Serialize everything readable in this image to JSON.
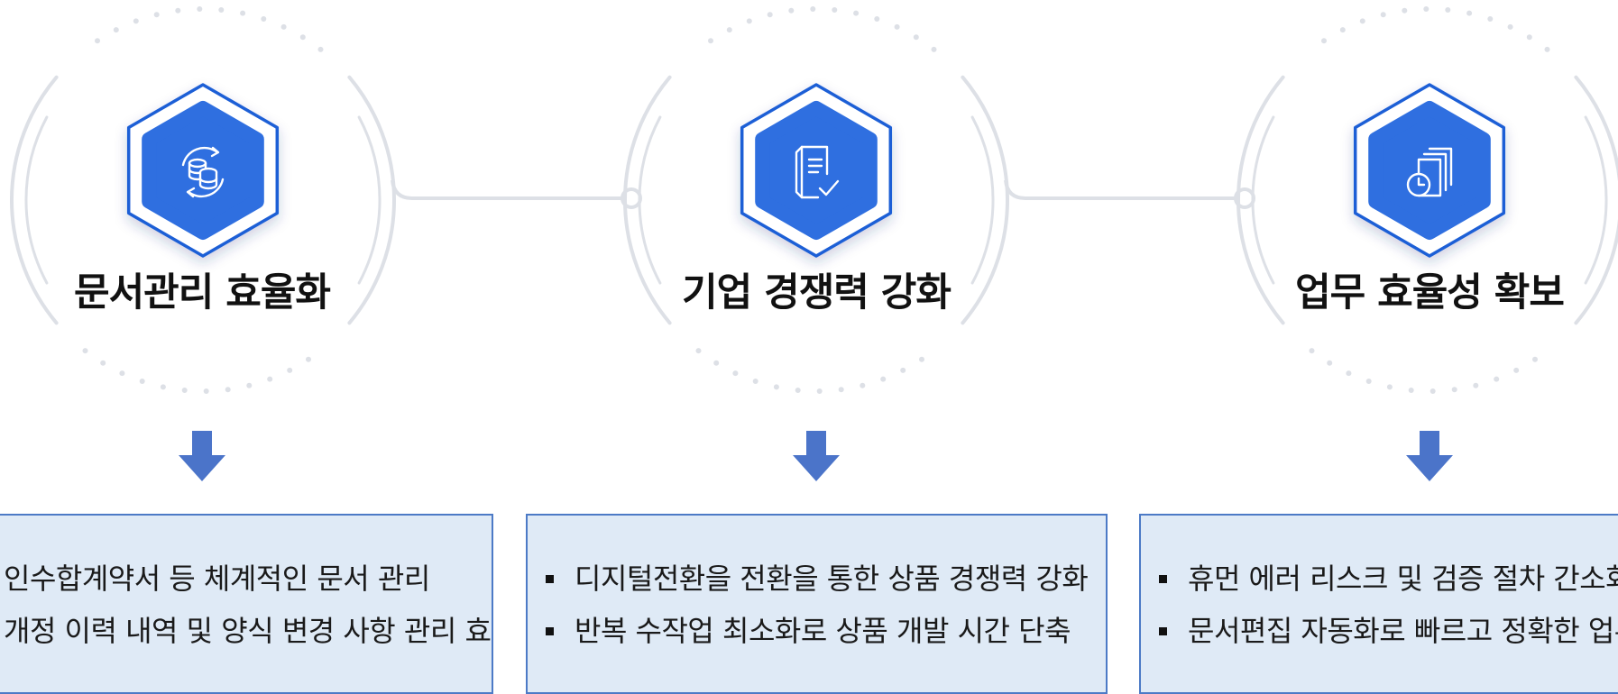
{
  "colors": {
    "primary_blue": "#2f6fe0",
    "hex_border": "#1e5ed6",
    "arrow_blue": "#4b74c9",
    "box_fill": "#dfeaf6",
    "box_border": "#4c7ac6",
    "ring_gray": "#dde0e6"
  },
  "features": [
    {
      "icon": "database-sync-icon",
      "title": "문서관리 효율화",
      "items": [
        "인수합계약서 등 체계적인 문서 관리",
        "개정 이력 내역 및 양식 변경 사항 관리 효율화"
      ]
    },
    {
      "icon": "document-check-icon",
      "title": "기업 경쟁력 강화",
      "items": [
        "디지털전환을 전환을 통한 상품 경쟁력 강화",
        "반복 수작업 최소화로 상품 개발 시간 단축"
      ]
    },
    {
      "icon": "document-history-icon",
      "title": "업무 효율성 확보",
      "items": [
        "휴먼 에러 리스크 및 검증 절차 간소화",
        "문서편집 자동화로 빠르고 정확한 업무 처리"
      ]
    }
  ]
}
